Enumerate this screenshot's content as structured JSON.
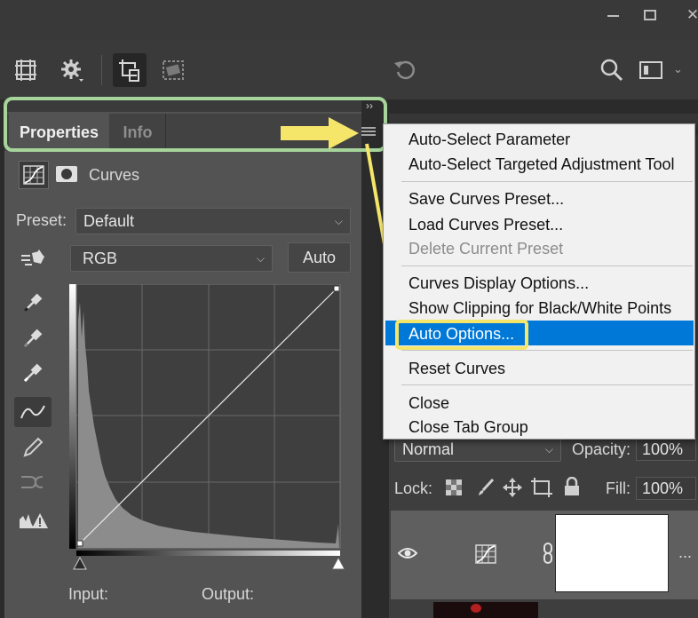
{
  "window": {
    "controls": [
      "minimize-icon",
      "restore-icon",
      "close-icon"
    ]
  },
  "options_bar": {
    "icons": [
      "grid-icon",
      "gear-icon",
      "crop-delete-icon",
      "crop-straighten-icon",
      "rotate-icon",
      "search-icon",
      "workspace-icon",
      "chevron-down-icon"
    ]
  },
  "properties_panel": {
    "collapse_glyph": "››",
    "tabs": [
      {
        "label": "Properties",
        "active": true
      },
      {
        "label": "Info",
        "active": false
      }
    ],
    "menu_icon": "hamburger-menu-icon",
    "adjustment_name": "Curves",
    "preset_label": "Preset:",
    "preset_value": "Default",
    "channel_value": "RGB",
    "auto_button": "Auto",
    "input_label": "Input:",
    "output_label": "Output:",
    "tools": [
      "target-adjust-icon",
      "black-eyedropper-icon",
      "gray-eyedropper-icon",
      "white-eyedropper-icon",
      "curve-point-icon",
      "pencil-icon",
      "smooth-icon",
      "clipping-warning-icon"
    ]
  },
  "flyout_menu": {
    "groups": [
      [
        {
          "label": "Auto-Select Parameter",
          "disabled": false
        },
        {
          "label": "Auto-Select Targeted Adjustment Tool",
          "disabled": false
        }
      ],
      [
        {
          "label": "Save Curves Preset...",
          "disabled": false
        },
        {
          "label": "Load Curves Preset...",
          "disabled": false
        },
        {
          "label": "Delete Current Preset",
          "disabled": true
        }
      ],
      [
        {
          "label": "Curves Display Options...",
          "disabled": false
        },
        {
          "label": "Show Clipping for Black/White Points",
          "disabled": false
        },
        {
          "label": "Auto Options...",
          "disabled": false,
          "highlighted": true
        }
      ],
      [
        {
          "label": "Reset Curves",
          "disabled": false
        }
      ],
      [
        {
          "label": "Close",
          "disabled": false
        },
        {
          "label": "Close Tab Group",
          "disabled": false
        }
      ]
    ]
  },
  "layers_panel": {
    "blend_mode": "Normal",
    "opacity_label": "Opacity:",
    "opacity_value": "100%",
    "lock_label": "Lock:",
    "fill_label": "Fill:",
    "fill_value": "100%",
    "more_glyph": "..."
  },
  "annotations": {
    "arrow_color": "#f5e66a",
    "green_frame_color": "#a6d49b",
    "yellow_box_color": "#f5e66a",
    "menu_highlight_color": "#0078d7"
  }
}
